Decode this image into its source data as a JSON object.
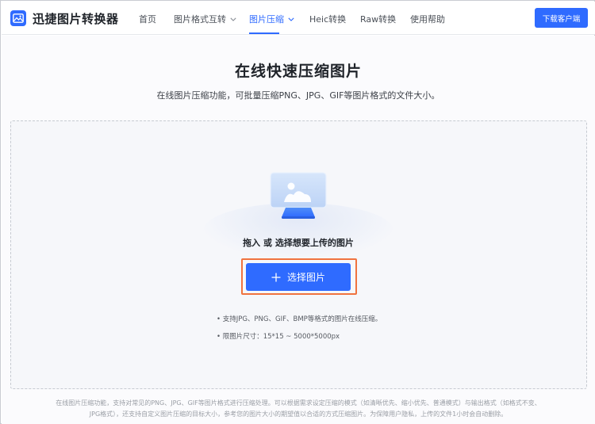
{
  "header": {
    "logo_text": "迅捷图片转换器",
    "nav": [
      {
        "label": "首页",
        "dropdown": false,
        "active": false
      },
      {
        "label": "图片格式互转",
        "dropdown": true,
        "active": false
      },
      {
        "label": "图片压缩",
        "dropdown": true,
        "active": true
      },
      {
        "label": "Heic转换",
        "dropdown": false,
        "active": false
      },
      {
        "label": "Raw转换",
        "dropdown": false,
        "active": false
      },
      {
        "label": "使用帮助",
        "dropdown": false,
        "active": false
      }
    ],
    "download_label": "下载客户端"
  },
  "main": {
    "title": "在线快速压缩图片",
    "subtitle": "在线图片压缩功能，可批量压缩PNG、JPG、GIF等图片格式的文件大小。",
    "drop_hint": "拖入 或 选择想要上传的图片",
    "select_label": "选择图片",
    "info": [
      "• 支持JPG、PNG、GIF、BMP等格式的图片在线压缩。",
      "• 限图片尺寸：15*15 ~ 5000*5000px"
    ]
  },
  "footer": {
    "note_line1": "在线图片压缩功能，支持对常见的PNG、JPG、GIF等图片格式进行压缩处理。可以根据需求设定压缩的模式（如清晰优先、缩小优先、普通模式）与输出格式（如格式不变、",
    "note_line2": "JPG格式），还支持自定义图片压缩的目标大小，参考您的图片大小的期望值以合适的方式压缩图片。为保障用户隐私，上传的文件1小时会自动删除。"
  },
  "colors": {
    "accent": "#2f6bff",
    "highlight": "#f0733f",
    "text": "#1f2329"
  }
}
